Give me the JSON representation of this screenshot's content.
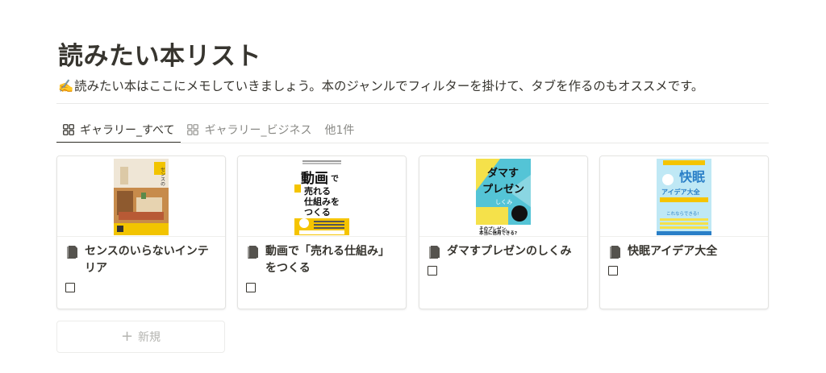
{
  "page": {
    "title": "読みたい本リスト",
    "description_icon": "✍️",
    "description": "読みたい本はここにメモしていきましょう。本のジャンルでフィルターを掛けて、タブを作るのもオススメです。"
  },
  "tabs": [
    {
      "label": "ギャラリー_すべて",
      "icon": "gallery-grid-icon",
      "active": true
    },
    {
      "label": "ギャラリー_ビジネス",
      "icon": "gallery-grid-icon",
      "active": false
    },
    {
      "label": "他1件",
      "icon": "",
      "active": false
    }
  ],
  "cards": [
    {
      "title": "センスのいらないインテリア",
      "cover_text": "センスのいらないインテリア",
      "checked": false
    },
    {
      "title": "動画で「売れる仕組み」をつくる",
      "cover_text": "動画で 売れる 仕組みを つくる",
      "checked": false
    },
    {
      "title": "ダマすプレゼンのしくみ",
      "cover_text": "ダマすプレゼン しくみ そのプレゼン、本当に信用できる?",
      "checked": false
    },
    {
      "title": "快眠アイデア大全",
      "cover_text": "快眠 アイデア大全 これならできる!",
      "checked": false
    }
  ],
  "new_button": {
    "label": "新規",
    "icon": "plus-icon"
  },
  "colors": {
    "text": "#37352f",
    "muted": "#8a8a86",
    "border": "#e3e3e1",
    "cover_yellow": "#f5c400",
    "cover_cyan": "#54c4d6"
  }
}
